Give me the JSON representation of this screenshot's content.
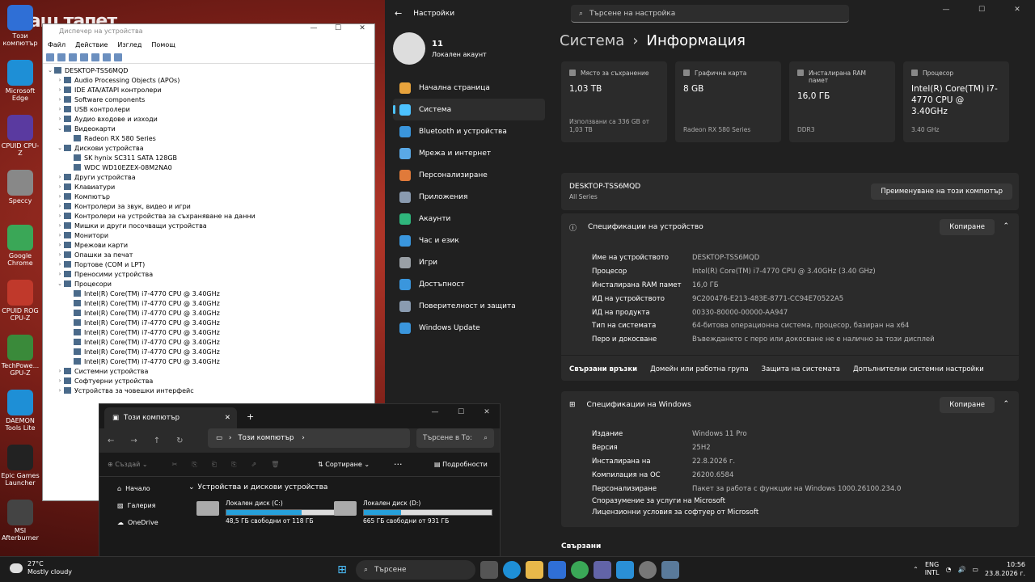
{
  "desktop": {
    "wallpaper_text": "Ваш тапет",
    "icons": [
      "Този компютър",
      "Microsoft Edge",
      "CPUID CPU-Z",
      "Speccy",
      "Google Chrome",
      "CPUID ROG CPU-Z",
      "TechPowe... GPU-Z",
      "DAEMON Tools Lite",
      "Epic Games Launcher",
      "MSI Afterburner"
    ]
  },
  "devmgr": {
    "title": "Диспечер на устройства",
    "menu": [
      "Файл",
      "Действие",
      "Изглед",
      "Помощ"
    ],
    "tree": [
      {
        "d": 0,
        "a": "v",
        "t": "DESKTOP-TSS6MQD"
      },
      {
        "d": 1,
        "a": ">",
        "t": "Audio Processing Objects (APOs)"
      },
      {
        "d": 1,
        "a": ">",
        "t": "IDE ATA/ATAPI контролери"
      },
      {
        "d": 1,
        "a": ">",
        "t": "Software components"
      },
      {
        "d": 1,
        "a": ">",
        "t": "USB контролери"
      },
      {
        "d": 1,
        "a": ">",
        "t": "Аудио входове и изходи"
      },
      {
        "d": 1,
        "a": "v",
        "t": "Видеокарти"
      },
      {
        "d": 2,
        "a": "",
        "t": "Radeon RX 580 Series"
      },
      {
        "d": 1,
        "a": "v",
        "t": "Дискови устройства"
      },
      {
        "d": 2,
        "a": "",
        "t": "SK hynix SC311 SATA 128GB"
      },
      {
        "d": 2,
        "a": "",
        "t": "WDC WD10EZEX-08M2NA0"
      },
      {
        "d": 1,
        "a": ">",
        "t": "Други устройства"
      },
      {
        "d": 1,
        "a": ">",
        "t": "Клавиатури"
      },
      {
        "d": 1,
        "a": ">",
        "t": "Компютър"
      },
      {
        "d": 1,
        "a": ">",
        "t": "Контролери за звук, видео и игри"
      },
      {
        "d": 1,
        "a": ">",
        "t": "Контролери на устройства за съхраняване на данни"
      },
      {
        "d": 1,
        "a": ">",
        "t": "Мишки и други посочващи устройства"
      },
      {
        "d": 1,
        "a": ">",
        "t": "Монитори"
      },
      {
        "d": 1,
        "a": ">",
        "t": "Мрежови карти"
      },
      {
        "d": 1,
        "a": ">",
        "t": "Опашки за печат"
      },
      {
        "d": 1,
        "a": ">",
        "t": "Портове (COM и LPT)"
      },
      {
        "d": 1,
        "a": ">",
        "t": "Преносими устройства"
      },
      {
        "d": 1,
        "a": "v",
        "t": "Процесори"
      },
      {
        "d": 2,
        "a": "",
        "t": "Intel(R) Core(TM) i7-4770 CPU @ 3.40GHz"
      },
      {
        "d": 2,
        "a": "",
        "t": "Intel(R) Core(TM) i7-4770 CPU @ 3.40GHz"
      },
      {
        "d": 2,
        "a": "",
        "t": "Intel(R) Core(TM) i7-4770 CPU @ 3.40GHz"
      },
      {
        "d": 2,
        "a": "",
        "t": "Intel(R) Core(TM) i7-4770 CPU @ 3.40GHz"
      },
      {
        "d": 2,
        "a": "",
        "t": "Intel(R) Core(TM) i7-4770 CPU @ 3.40GHz"
      },
      {
        "d": 2,
        "a": "",
        "t": "Intel(R) Core(TM) i7-4770 CPU @ 3.40GHz"
      },
      {
        "d": 2,
        "a": "",
        "t": "Intel(R) Core(TM) i7-4770 CPU @ 3.40GHz"
      },
      {
        "d": 2,
        "a": "",
        "t": "Intel(R) Core(TM) i7-4770 CPU @ 3.40GHz"
      },
      {
        "d": 1,
        "a": ">",
        "t": "Системни устройства"
      },
      {
        "d": 1,
        "a": ">",
        "t": "Софтуерни устройства"
      },
      {
        "d": 1,
        "a": ">",
        "t": "Устройства за човешки интерфейс"
      }
    ]
  },
  "settings": {
    "app_title": "Настройки",
    "search_placeholder": "Търсене на настройка",
    "user_name": "11",
    "user_sub": "Локален акаунт",
    "nav": [
      {
        "label": "Начална страница",
        "color": "#e8a33c"
      },
      {
        "label": "Система",
        "color": "#4cc2ff",
        "active": true
      },
      {
        "label": "Bluetooth и устройства",
        "color": "#3a96dd"
      },
      {
        "label": "Мрежа и интернет",
        "color": "#5aa9e6"
      },
      {
        "label": "Персонализиране",
        "color": "#e07a3a"
      },
      {
        "label": "Приложения",
        "color": "#8a9bb0"
      },
      {
        "label": "Акаунти",
        "color": "#2fb67c"
      },
      {
        "label": "Час и език",
        "color": "#3a96dd"
      },
      {
        "label": "Игри",
        "color": "#9aa0a6"
      },
      {
        "label": "Достъпност",
        "color": "#3a96dd"
      },
      {
        "label": "Поверителност и защита",
        "color": "#8a9bb0"
      },
      {
        "label": "Windows Update",
        "color": "#3a96dd"
      }
    ],
    "heading_parent": "Система",
    "heading_sep": "›",
    "heading_current": "Информация",
    "cards": [
      {
        "label": "Място за съхранение",
        "value": "1,03 TB",
        "sub": "Използвани са 336 GB от 1,03 TB"
      },
      {
        "label": "Графична карта",
        "value": "8 GB",
        "sub": "Radeon RX 580 Series"
      },
      {
        "label": "Инсталирана RAM памет",
        "value": "16,0 ГБ",
        "sub": "DDR3"
      },
      {
        "label": "Процесор",
        "value": "Intel(R) Core(TM) i7-4770 CPU @ 3.40GHz",
        "sub": "3.40 GHz"
      }
    ],
    "device_name": "DESKTOP-TSS6MQD",
    "device_series": "All Series",
    "rename_button": "Преименуване на този компютър",
    "device_specs_title": "Спецификации на устройство",
    "copy_button": "Копиране",
    "device_specs": [
      {
        "k": "Име на устройството",
        "v": "DESKTOP-TSS6MQD"
      },
      {
        "k": "Процесор",
        "v": "Intel(R) Core(TM) i7-4770 CPU @ 3.40GHz (3.40 GHz)"
      },
      {
        "k": "Инсталирана RAM памет",
        "v": "16,0 ГБ"
      },
      {
        "k": "ИД на устройството",
        "v": "9C200476-E213-483E-8771-CC94E70522A5"
      },
      {
        "k": "ИД на продукта",
        "v": "00330-80000-00000-AA947"
      },
      {
        "k": "Тип на системата",
        "v": "64-битова операционна система, процесор, базиран на x64"
      },
      {
        "k": "Перо и докосване",
        "v": "Въвеждането с перо или докосване не е налично за този дисплей"
      }
    ],
    "related_label": "Свързани връзки",
    "related_links": [
      "Домейн или работна група",
      "Защита на системата",
      "Допълнителни системни настройки"
    ],
    "win_specs_title": "Спецификации на Windows",
    "win_specs": [
      {
        "k": "Издание",
        "v": "Windows 11 Pro"
      },
      {
        "k": "Версия",
        "v": "25H2"
      },
      {
        "k": "Инсталирана на",
        "v": "22.8.2026 г."
      },
      {
        "k": "Компилация на ОС",
        "v": "26200.6584"
      },
      {
        "k": "Персонализиране",
        "v": "Пакет за работа с функции на Windows 1000.26100.234.0"
      }
    ],
    "win_links": [
      "Споразумение за услуги на Microsoft",
      "Лицензионни условия за софтуер от Microsoft"
    ],
    "related_section": "Свързани"
  },
  "explorer": {
    "tab_title": "Този компютър",
    "address": "Този компютър",
    "search_placeholder": "Търсене в То:",
    "new_button": "Създай",
    "sort_button": "Сортиране",
    "details_button": "Подробности",
    "sidebar": [
      "Начало",
      "Галерия",
      "OneDrive"
    ],
    "group_title": "Устройства и дискови устройства",
    "drives": [
      {
        "name": "Локален диск (C:)",
        "free": "48,5 ГБ свободни от 118 ГБ",
        "used": 0.59
      },
      {
        "name": "Локален диск (D:)",
        "free": "665 ГБ свободни от 931 ГБ",
        "used": 0.29
      }
    ]
  },
  "taskbar": {
    "temp": "27°C",
    "weather": "Mostly cloudy",
    "search": "Търсене",
    "lang1": "ENG",
    "lang2": "INTL",
    "time": "10:56",
    "date": "23.8.2026 г."
  }
}
